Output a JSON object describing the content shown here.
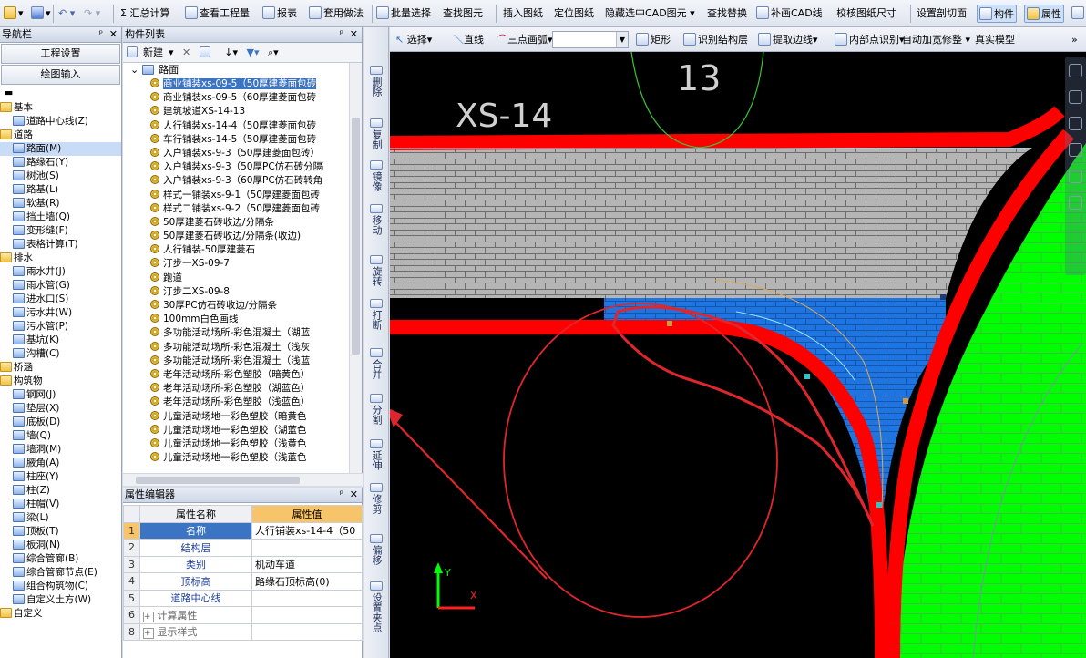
{
  "toolbar": {
    "calc_total": "汇总计算",
    "view_qty": "查看工程量",
    "report": "报表",
    "apply_method": "套用做法",
    "batch_select": "批量选择",
    "find_elem": "查找图元",
    "insert_drawing": "插入图纸",
    "locate_drawing": "定位图纸",
    "hide_cad": "隐藏选中CAD图元",
    "find_replace": "查找替换",
    "add_cad_line": "补画CAD线",
    "check_size": "校核图纸尺寸",
    "set_section": "设置剖切面",
    "component_toggle": "构件",
    "property_toggle": "属性"
  },
  "nav_panel": {
    "title": "导航栏",
    "btn_project": "工程设置",
    "btn_draw": "绘图输入",
    "tree": [
      {
        "label": "基本",
        "type": "folder",
        "level": 0
      },
      {
        "label": "道路中心线(Z)",
        "type": "item",
        "level": 1
      },
      {
        "label": "道路",
        "type": "folder",
        "level": 0
      },
      {
        "label": "路面(M)",
        "type": "item",
        "level": 1,
        "selected": true
      },
      {
        "label": "路缘石(Y)",
        "type": "item",
        "level": 1
      },
      {
        "label": "树池(S)",
        "type": "item",
        "level": 1
      },
      {
        "label": "路基(L)",
        "type": "item",
        "level": 1
      },
      {
        "label": "软基(R)",
        "type": "item",
        "level": 1
      },
      {
        "label": "挡土墙(Q)",
        "type": "item",
        "level": 1
      },
      {
        "label": "变形缝(F)",
        "type": "item",
        "level": 1
      },
      {
        "label": "表格计算(T)",
        "type": "item",
        "level": 1
      },
      {
        "label": "排水",
        "type": "folder",
        "level": 0
      },
      {
        "label": "雨水井(J)",
        "type": "item",
        "level": 1
      },
      {
        "label": "雨水管(G)",
        "type": "item",
        "level": 1
      },
      {
        "label": "进水口(S)",
        "type": "item",
        "level": 1
      },
      {
        "label": "污水井(W)",
        "type": "item",
        "level": 1
      },
      {
        "label": "污水管(P)",
        "type": "item",
        "level": 1
      },
      {
        "label": "基坑(K)",
        "type": "item",
        "level": 1
      },
      {
        "label": "沟槽(C)",
        "type": "item",
        "level": 1
      },
      {
        "label": "桥涵",
        "type": "folder",
        "level": 0
      },
      {
        "label": "构筑物",
        "type": "folder",
        "level": 0
      },
      {
        "label": "钢网(J)",
        "type": "item",
        "level": 1
      },
      {
        "label": "垫层(X)",
        "type": "item",
        "level": 1
      },
      {
        "label": "底板(D)",
        "type": "item",
        "level": 1
      },
      {
        "label": "墙(Q)",
        "type": "item",
        "level": 1
      },
      {
        "label": "墙洞(M)",
        "type": "item",
        "level": 1
      },
      {
        "label": "腋角(A)",
        "type": "item",
        "level": 1
      },
      {
        "label": "柱座(Y)",
        "type": "item",
        "level": 1
      },
      {
        "label": "柱(Z)",
        "type": "item",
        "level": 1
      },
      {
        "label": "柱帽(V)",
        "type": "item",
        "level": 1
      },
      {
        "label": "梁(L)",
        "type": "item",
        "level": 1
      },
      {
        "label": "顶板(T)",
        "type": "item",
        "level": 1
      },
      {
        "label": "板洞(N)",
        "type": "item",
        "level": 1
      },
      {
        "label": "综合管廊(B)",
        "type": "item",
        "level": 1
      },
      {
        "label": "综合管廊节点(E)",
        "type": "item",
        "level": 1
      },
      {
        "label": "组合构筑物(C)",
        "type": "item",
        "level": 1
      },
      {
        "label": "自定义土方(W)",
        "type": "item",
        "level": 1
      },
      {
        "label": "自定义",
        "type": "folder",
        "level": 0
      }
    ]
  },
  "component_list": {
    "title": "构件列表",
    "toolbar_new": "新建",
    "root": "路面",
    "items": [
      "商业铺装xs-09-5（50厚建菱面包砖",
      "商业铺装xs-09-5（60厚建菱面包砖",
      "建筑坡道XS-14-13",
      "人行铺装xs-14-4（50厚建菱面包砖",
      "车行铺装xs-14-5（50厚建菱面包砖",
      "入户铺装xs-9-3（50厚建菱面包砖）",
      "入户铺装xs-9-3（50厚PC仿石砖分隔",
      "入户铺装xs-9-3（60厚PC仿石砖转角",
      "样式一铺装xs-9-1（50厚建菱面包砖",
      "样式二铺装xs-9-2（50厚建菱面包砖",
      "50厚建菱石砖收边/分隔条",
      "50厚建菱石砖收边/分隔条(收边)",
      "人行铺装-50厚建菱石",
      "汀步一XS-09-7",
      "跑道",
      "汀步二XS-09-8",
      "30厚PC仿石砖收边/分隔条",
      "100mm白色画线",
      "多功能活动场所-彩色混凝土（湖蓝",
      "多功能活动场所-彩色混凝土（浅灰",
      "多功能活动场所-彩色混凝土（浅蓝",
      "老年活动场所-彩色塑胶（暗黄色）",
      "老年活动场所-彩色塑胶（湖蓝色）",
      "老年活动场所-彩色塑胶（浅蓝色）",
      "儿童活动场地一彩色塑胶（暗黄色",
      "儿童活动场地一彩色塑胶（湖蓝色",
      "儿童活动场地一彩色塑胶（浅黄色",
      "儿童活动场地一彩色塑胶（浅蓝色"
    ]
  },
  "property_editor": {
    "title": "属性编辑器",
    "col_name": "属性名称",
    "col_value": "属性值",
    "rows": [
      {
        "num": "1",
        "name": "名称",
        "value": "人行铺装xs-14-4（50"
      },
      {
        "num": "2",
        "name": "结构层",
        "value": ""
      },
      {
        "num": "3",
        "name": "类别",
        "value": "机动车道"
      },
      {
        "num": "4",
        "name": "顶标高",
        "value": "路缘石顶标高(0)"
      },
      {
        "num": "5",
        "name": "道路中心线",
        "value": ""
      },
      {
        "num": "6",
        "name": "计算属性",
        "value": ""
      },
      {
        "num": "8",
        "name": "显示样式",
        "value": ""
      }
    ]
  },
  "edit_strip": {
    "buttons": [
      "删除",
      "复制",
      "镜像",
      "移动",
      "旋转",
      "打断",
      "合并",
      "分割",
      "延伸",
      "修剪",
      "偏移",
      "设置夹点"
    ]
  },
  "draw_toolbar": {
    "select": "选择",
    "line": "直线",
    "arc": "三点画弧",
    "rect": "矩形",
    "identify_layer": "识别结构层",
    "extract_edge": "提取边线",
    "inner_point": "内部点识别",
    "auto_widen": "自动加宽修整",
    "real_model": "真实模型"
  },
  "canvas": {
    "label_xs": "XS-14",
    "label_num": "13",
    "axis_y": "Y",
    "axis_x": "X"
  },
  "colors": {
    "curb_red": "#ff0000",
    "green_area": "#00ff00",
    "blue_area": "#1e74e0",
    "paving_grey": "#b5b5b5",
    "selection_blue": "#3c74c4"
  }
}
